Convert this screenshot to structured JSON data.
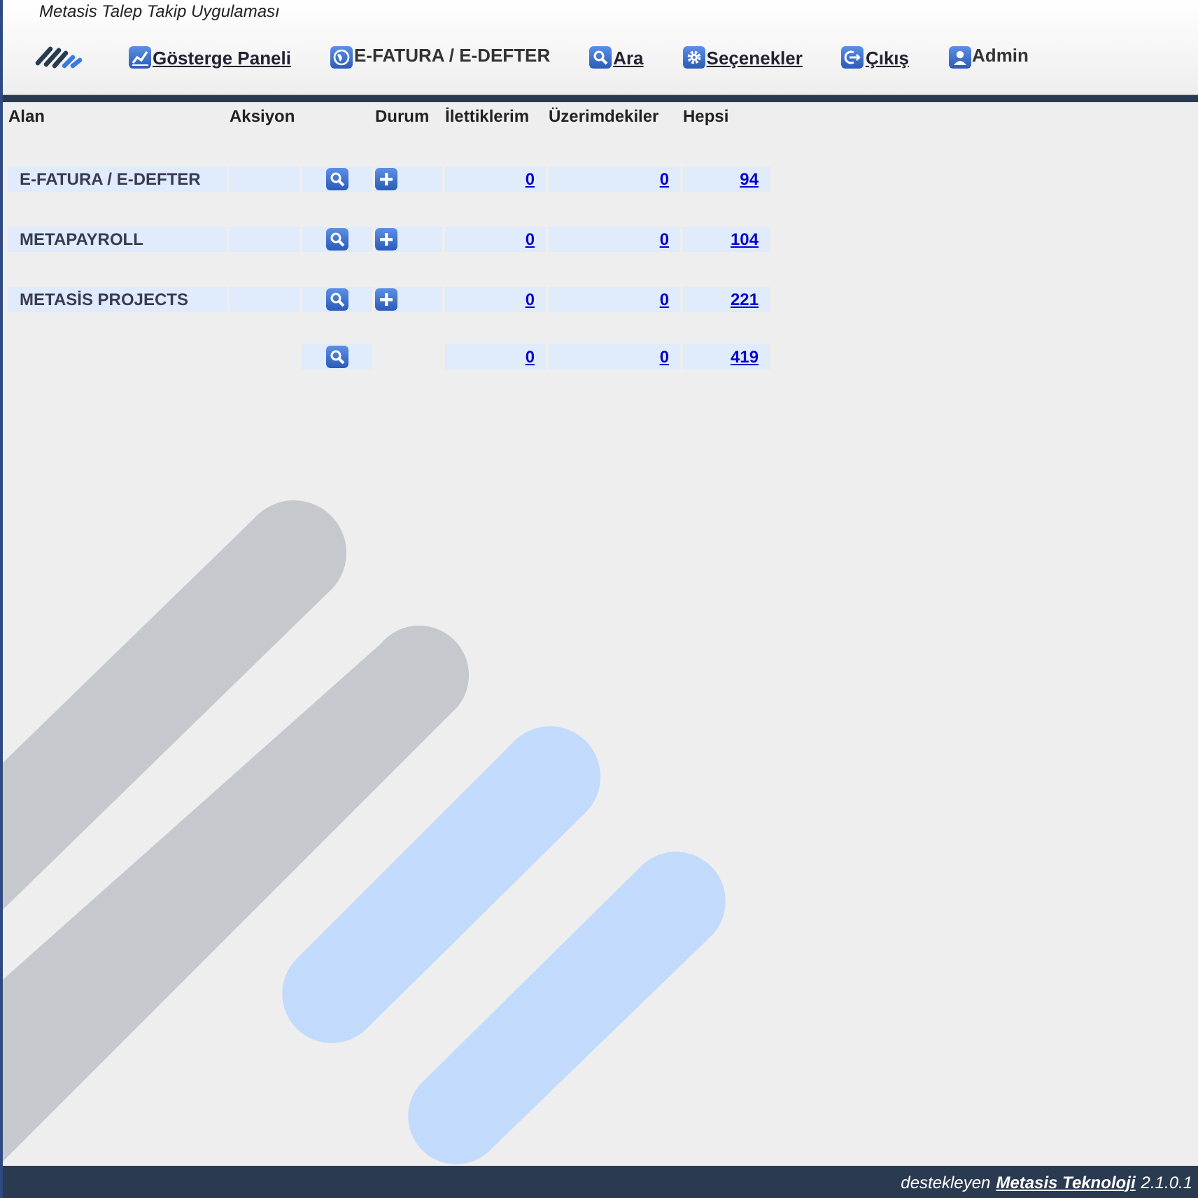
{
  "app_title": "Metasis Talep Takip Uygulaması",
  "nav": [
    {
      "label": "Gösterge Paneli",
      "kind": "chart",
      "underlined": true
    },
    {
      "label": "E-FATURA / E-DEFTER",
      "kind": "globe",
      "underlined": false
    },
    {
      "label": "Ara",
      "kind": "search",
      "underlined": true
    },
    {
      "label": "Seçenekler",
      "kind": "gear",
      "underlined": true
    },
    {
      "label": "Çıkış",
      "kind": "exit",
      "underlined": true
    },
    {
      "label": "Admin",
      "kind": "user",
      "underlined": false
    }
  ],
  "table": {
    "columns": [
      "Alan",
      "Aksiyon",
      "Durum",
      "İlettiklerim",
      "Üzerimdekiler",
      "Hepsi"
    ],
    "rows": [
      {
        "kind": "area",
        "name": "E-FATURA / E-DEFTER",
        "forwarded": "0",
        "assigned": "0",
        "all": "94"
      },
      {
        "kind": "area",
        "name": "METAPAYROLL",
        "forwarded": "0",
        "assigned": "0",
        "all": "104"
      },
      {
        "kind": "area",
        "name": "METASİS PROJECTS",
        "forwarded": "0",
        "assigned": "0",
        "all": "221"
      },
      {
        "kind": "total",
        "forwarded": "0",
        "assigned": "0",
        "all": "419"
      }
    ]
  },
  "footer": {
    "prefix": "destekleyen",
    "link": "Metasis Teknoloji",
    "version": "2.1.0.1"
  }
}
